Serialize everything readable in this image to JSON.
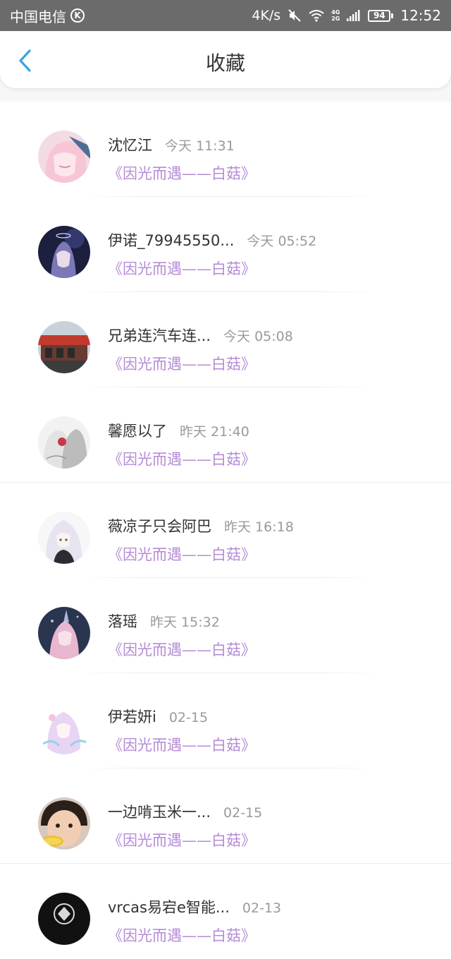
{
  "status_bar": {
    "carrier": "中国电信",
    "carrier_badge": "K",
    "net_speed": "4K/s",
    "net_type_top": "4G",
    "net_type_bottom": "2G",
    "battery": "94",
    "time": "12:52"
  },
  "header": {
    "title": "收藏",
    "back_icon": "chevron-left-icon",
    "accent_color": "#3aa3e3"
  },
  "colors": {
    "link": "#b58bd6",
    "timestamp": "#9a9a9a",
    "status_bar_bg": "#6b6b6b"
  },
  "favorites": [
    {
      "name": "沈忆江",
      "time": "今天 11:31",
      "title": "《因光而遇——白菇》",
      "avatar": "anime-pink-hair"
    },
    {
      "name": "伊诺_79945550...",
      "time": "今天 05:52",
      "title": "《因光而遇——白菇》",
      "avatar": "anime-dark-blue"
    },
    {
      "name": "兄弟连汽车连...",
      "time": "今天 05:08",
      "title": "《因光而遇——白菇》",
      "avatar": "storefront-photo"
    },
    {
      "name": "馨愿以了",
      "time": "昨天 21:40",
      "title": "《因光而遇——白菇》",
      "avatar": "anime-grey-pair"
    },
    {
      "name": "薇凉子只会阿巴",
      "time": "昨天 16:18",
      "title": "《因光而遇——白菇》",
      "avatar": "anime-white-hair"
    },
    {
      "name": "落瑶",
      "time": "昨天 15:32",
      "title": "《因光而遇——白菇》",
      "avatar": "anime-galaxy"
    },
    {
      "name": "伊若妍i",
      "time": "02-15",
      "title": "《因光而遇——白菇》",
      "avatar": "anime-lilac-hair"
    },
    {
      "name": "一边啃玉米一...",
      "time": "02-15",
      "title": "《因光而遇——白菇》",
      "avatar": "child-eating-corn"
    },
    {
      "name": "vrcas易宕e智能...",
      "time": "02-13",
      "title": "《因光而遇——白菇》",
      "avatar": "dark-logo"
    }
  ]
}
